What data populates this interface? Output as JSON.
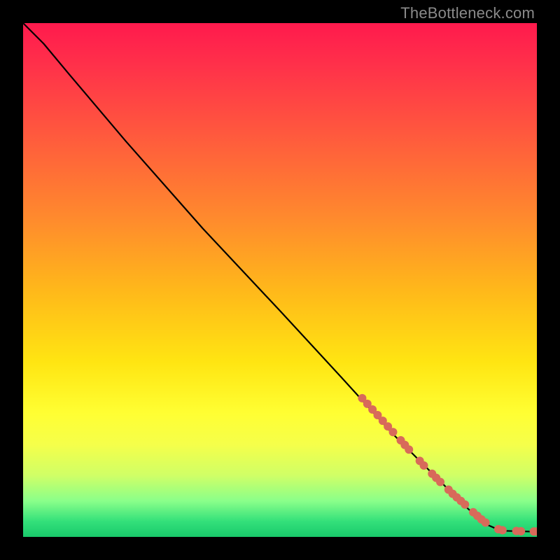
{
  "watermark": "TheBottleneck.com",
  "chart_data": {
    "type": "line",
    "title": "",
    "xlabel": "",
    "ylabel": "",
    "xlim": [
      0,
      100
    ],
    "ylim": [
      0,
      100
    ],
    "grid": false,
    "legend": false,
    "background_gradient": {
      "direction": "vertical",
      "stops": [
        {
          "pos": 0,
          "color": "#ff1a4d"
        },
        {
          "pos": 50,
          "color": "#ffb81a"
        },
        {
          "pos": 78,
          "color": "#ffff33"
        },
        {
          "pos": 100,
          "color": "#19c96b"
        }
      ]
    },
    "curve": {
      "description": "Decreasing bottleneck curve",
      "points": [
        {
          "x": 0,
          "y": 100
        },
        {
          "x": 4,
          "y": 96
        },
        {
          "x": 9,
          "y": 90
        },
        {
          "x": 20,
          "y": 77
        },
        {
          "x": 35,
          "y": 60
        },
        {
          "x": 50,
          "y": 44
        },
        {
          "x": 62,
          "y": 31
        },
        {
          "x": 72,
          "y": 20
        },
        {
          "x": 80,
          "y": 12
        },
        {
          "x": 86,
          "y": 6
        },
        {
          "x": 90,
          "y": 2.5
        },
        {
          "x": 93,
          "y": 1.2
        },
        {
          "x": 100,
          "y": 1.0
        }
      ]
    },
    "highlight_segments": {
      "description": "Thick salmon dotted overlay along lower-right portion of curve",
      "color": "#d86a5a",
      "radius": 5.5,
      "points": [
        {
          "x": 66,
          "y": 27.0
        },
        {
          "x": 67,
          "y": 25.9
        },
        {
          "x": 68,
          "y": 24.8
        },
        {
          "x": 69,
          "y": 23.7
        },
        {
          "x": 70,
          "y": 22.6
        },
        {
          "x": 71,
          "y": 21.5
        },
        {
          "x": 72,
          "y": 20.4
        },
        {
          "x": 73.5,
          "y": 18.8
        },
        {
          "x": 74.3,
          "y": 17.9
        },
        {
          "x": 75.1,
          "y": 17.0
        },
        {
          "x": 77.2,
          "y": 14.8
        },
        {
          "x": 78.0,
          "y": 13.9
        },
        {
          "x": 79.6,
          "y": 12.3
        },
        {
          "x": 80.4,
          "y": 11.5
        },
        {
          "x": 81.2,
          "y": 10.7
        },
        {
          "x": 82.8,
          "y": 9.2
        },
        {
          "x": 83.6,
          "y": 8.4
        },
        {
          "x": 84.4,
          "y": 7.7
        },
        {
          "x": 85.2,
          "y": 7.0
        },
        {
          "x": 86.0,
          "y": 6.3
        },
        {
          "x": 87.6,
          "y": 4.8
        },
        {
          "x": 88.4,
          "y": 4.1
        },
        {
          "x": 89.2,
          "y": 3.4
        },
        {
          "x": 90.0,
          "y": 2.8
        },
        {
          "x": 92.5,
          "y": 1.5
        },
        {
          "x": 93.3,
          "y": 1.3
        },
        {
          "x": 96.0,
          "y": 1.15
        },
        {
          "x": 96.9,
          "y": 1.1
        },
        {
          "x": 99.4,
          "y": 1.05
        },
        {
          "x": 100.0,
          "y": 1.05
        }
      ]
    }
  }
}
